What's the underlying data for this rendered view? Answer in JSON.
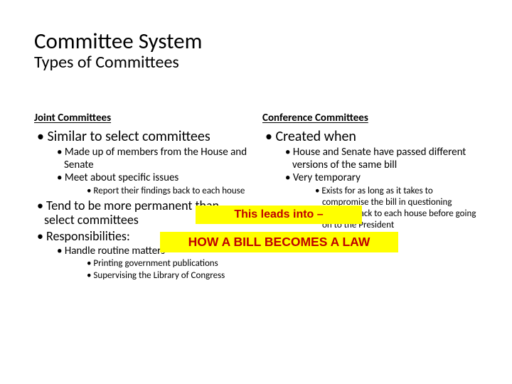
{
  "title": "Committee System",
  "subtitle": "Types of Committees",
  "left": {
    "heading": "Joint Committees",
    "b1": "Similar to select committees",
    "b1a": "Made up of members from the House and Senate",
    "b1b": "Meet about specific issues",
    "b1b1": "Report their findings back to each house",
    "b2": "Tend to be more permanent than select committees",
    "b3": "Responsibilities:",
    "b3a": "Handle routine matters",
    "b3a1": "Printing government publications",
    "b3a2": "Supervising the Library of Congress"
  },
  "right": {
    "heading": "Conference Committees",
    "b1": "Created when",
    "b1a": "House and Senate have passed different versions of the same bill",
    "b1b": "Very temporary",
    "b1b1": "Exists for as long as it takes to compromise the bill in questioning",
    "b1b2": "Bill goes back to each house before going on to the President"
  },
  "callout1": "This leads into –",
  "callout2": "HOW A BILL BECOMES A LAW"
}
